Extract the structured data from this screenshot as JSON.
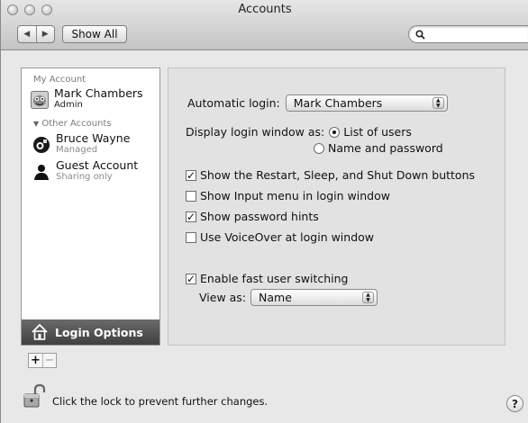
{
  "window": {
    "title": "Accounts"
  },
  "toolbar": {
    "back_glyph": "◀",
    "forward_glyph": "▶",
    "show_all_label": "Show All",
    "search_placeholder": "",
    "search_icon": "search-icon"
  },
  "sidebar": {
    "my_account_header": "My Account",
    "my_account": {
      "name": "Mark Chambers",
      "role": "Admin",
      "icon": "user-picture-icon"
    },
    "other_accounts_header": "Other Accounts",
    "other_accounts": [
      {
        "name": "Bruce Wayne",
        "role": "Managed",
        "icon": "managed-user-icon"
      },
      {
        "name": "Guest Account",
        "role": "Sharing only",
        "icon": "person-silhouette-icon"
      }
    ],
    "login_options_label": "Login Options",
    "add_glyph": "+",
    "remove_glyph": "−"
  },
  "login_options": {
    "automatic_login_label": "Automatic login:",
    "automatic_login_value": "Mark Chambers",
    "display_login_window_label": "Display login window as:",
    "display_options": [
      {
        "label": "List of users",
        "selected": true
      },
      {
        "label": "Name and password",
        "selected": false
      }
    ],
    "checkboxes": [
      {
        "label": "Show the Restart, Sleep, and Shut Down buttons",
        "checked": true
      },
      {
        "label": "Show Input menu in login window",
        "checked": false
      },
      {
        "label": "Show password hints",
        "checked": true
      },
      {
        "label": "Use VoiceOver at login window",
        "checked": false
      }
    ],
    "fast_user_switching": {
      "label": "Enable fast user switching",
      "checked": true
    },
    "view_as_label": "View as:",
    "view_as_value": "Name"
  },
  "footer": {
    "lock_text": "Click the lock to prevent further changes.",
    "help_glyph": "?"
  },
  "colors": {
    "sidebar_selected": "#4a4a4a",
    "panel_bg": "#e2e2e2",
    "window_bg": "#e8e8e8"
  }
}
